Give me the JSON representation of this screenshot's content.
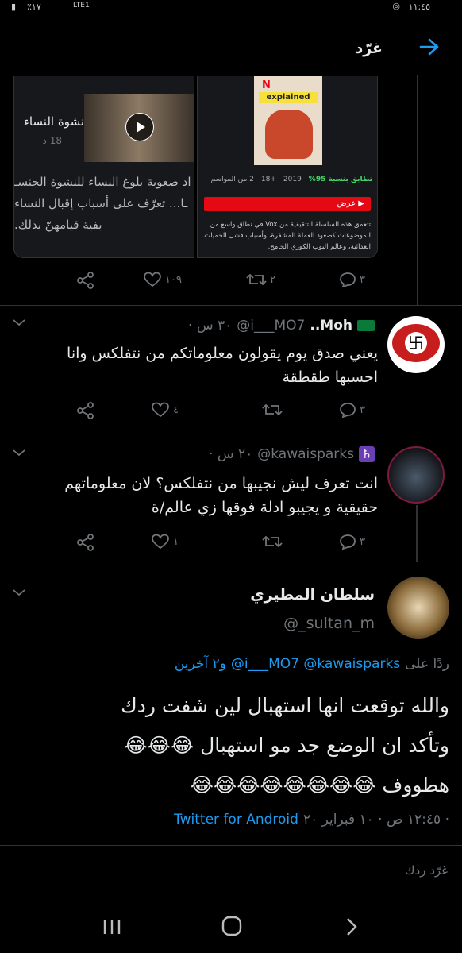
{
  "status": {
    "time": "١١:٤٥",
    "battery": "٪١٧",
    "network": "LTE1"
  },
  "header": {
    "title": "غرّد"
  },
  "card_left": {
    "title": "نشوة النساء",
    "duration": "18 د",
    "desc_lines": [
      "اد صعوبة بلوغ النساء للنشوة الجنسـ",
      "ـا... تعرّف على أسباب إقبال النساء",
      "بفية قيامهنّ بذلك."
    ]
  },
  "card_right": {
    "poster_text": "explained",
    "match": "تطابق بنسبة 95%",
    "year": "2019",
    "age": "+18",
    "seasons": "2 من المواسم",
    "play_label": "عرض",
    "desc": "تتعمق هذه السلسلة التثقيفية من Vox في نطاق واسع من الموضوعات كصعود العملة المشفرة، وأسباب فشل الحميات الغذائية، وعالم البوب الكوري الجامح."
  },
  "tweet0_actions": {
    "replies": "٣",
    "retweets": "٢",
    "likes": "١٠٩"
  },
  "tweet1": {
    "name": "..Moh",
    "handle": "@i___MO7",
    "time": "· ٣٠ س",
    "text_lines": [
      "يعني صدق يوم يقولون معلوماتكم من نتفلكس وانا",
      "احسبها طقطقة"
    ],
    "replies": "٣",
    "retweets": "",
    "likes": "٤"
  },
  "tweet2": {
    "name": "♄",
    "handle": "@kawaisparks",
    "time": "· ٢٠ س",
    "text_lines": [
      "انت تعرف ليش نجيبها من نتفلكس؟ لان معلوماتهم",
      "حقيقية و يجيبو ادلة فوقها زي عالم/ة"
    ],
    "replies": "٣",
    "retweets": "",
    "likes": "١"
  },
  "main_tweet": {
    "name": "سلطان المطيري",
    "handle": "@_sultan_m",
    "reply_prefix": "ردًا على",
    "reply_to": "@i___MO7 @kawaisparks",
    "reply_others": "و٢ آخرين",
    "text_lines": [
      "والله توقعت انها استهبال لين شفت ردك",
      "وتأكد ان الوضع جد مو استهبال 😂😂😂",
      "هطووف 😂😂😂😂😂😂😂😂"
    ],
    "meta_time": "١٢:٤٥ ص · ١٠ فبراير ٢٠ ·",
    "source": "Twitter for Android"
  },
  "reply_box": {
    "placeholder": "غرّد ردك"
  },
  "colors": {
    "accent": "#1d9bf0",
    "bg": "#000000",
    "muted": "#71767b",
    "netflix": "#e50914",
    "match": "#46d369"
  }
}
